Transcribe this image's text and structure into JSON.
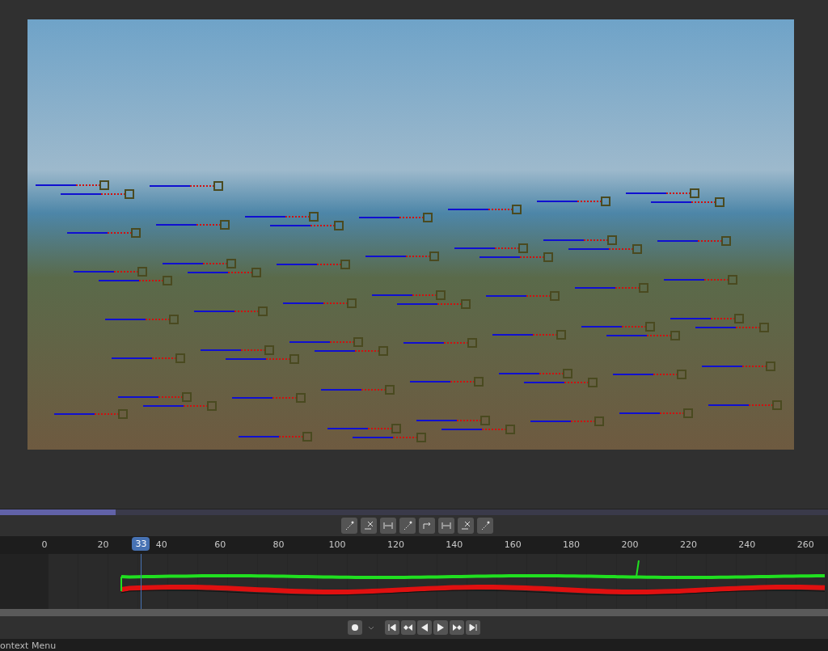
{
  "clip_view": {
    "progress": {
      "level": 0.14
    }
  },
  "toolbar": {
    "buttons": [
      {
        "kind": "bend"
      },
      {
        "kind": "clear"
      },
      {
        "kind": "first"
      },
      {
        "kind": "back"
      },
      {
        "kind": "fwd"
      },
      {
        "kind": "last"
      },
      {
        "kind": "clearx"
      },
      {
        "kind": "bend2"
      }
    ]
  },
  "timeline": {
    "ticks": [
      "0",
      "20",
      "40",
      "60",
      "80",
      "100",
      "120",
      "140",
      "160",
      "180",
      "200",
      "220",
      "240",
      "260"
    ],
    "current_frame": "33"
  },
  "playback": {
    "buttons": [
      {
        "kind": "record"
      },
      {
        "kind": "dropdown"
      },
      {
        "kind": "jump-start"
      },
      {
        "kind": "prev-key"
      },
      {
        "kind": "play-back"
      },
      {
        "kind": "play"
      },
      {
        "kind": "next-key"
      },
      {
        "kind": "jump-end"
      }
    ]
  },
  "status_bar": {
    "text": "ontext Menu"
  }
}
